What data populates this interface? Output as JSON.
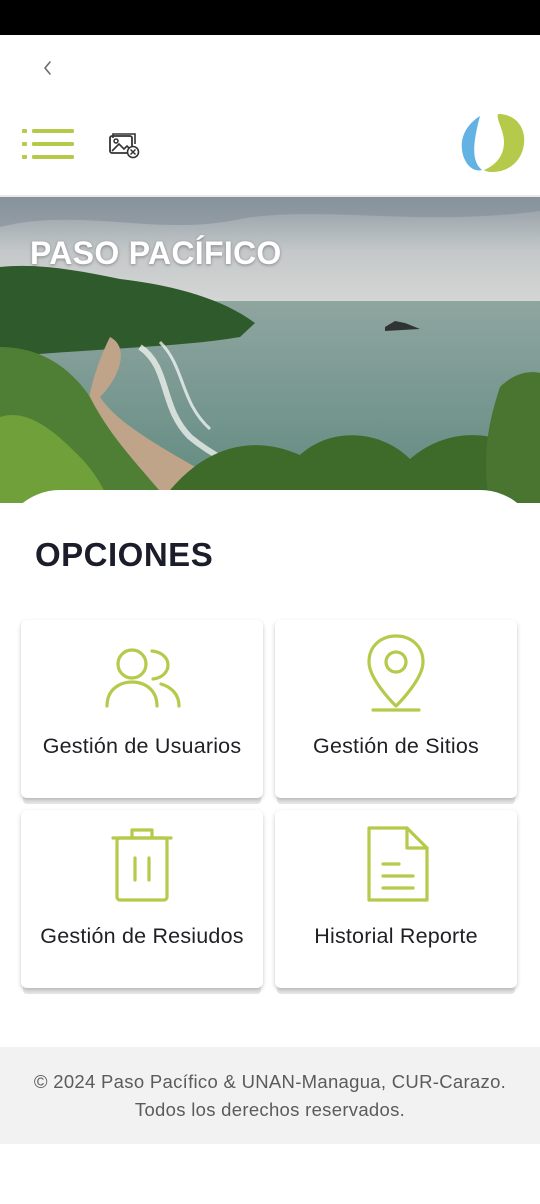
{
  "header": {
    "back_icon": "chevron-left-icon",
    "menu_icon": "list-menu-icon",
    "gallery_icon": "image-off-icon",
    "logo_icon": "paso-pacifico-logo"
  },
  "hero": {
    "title": "PASO PACÍFICO"
  },
  "main": {
    "section_title": "OPCIONES",
    "options": [
      {
        "label": "Gestión de Usuarios",
        "icon": "users-icon"
      },
      {
        "label": "Gestión de Sitios",
        "icon": "map-pin-icon"
      },
      {
        "label": "Gestión de Resiudos",
        "icon": "trash-icon"
      },
      {
        "label": "Historial Reporte",
        "icon": "document-icon"
      }
    ]
  },
  "footer": {
    "line1": "© 2024 Paso Pacífico & UNAN-Managua, CUR-Carazo.",
    "line2": "Todos los derechos reservados."
  },
  "colors": {
    "accent": "#b5c94a",
    "logo_blue": "#62b3e4",
    "title_text": "#1b1d2a",
    "footer_bg": "#f2f2f2"
  }
}
